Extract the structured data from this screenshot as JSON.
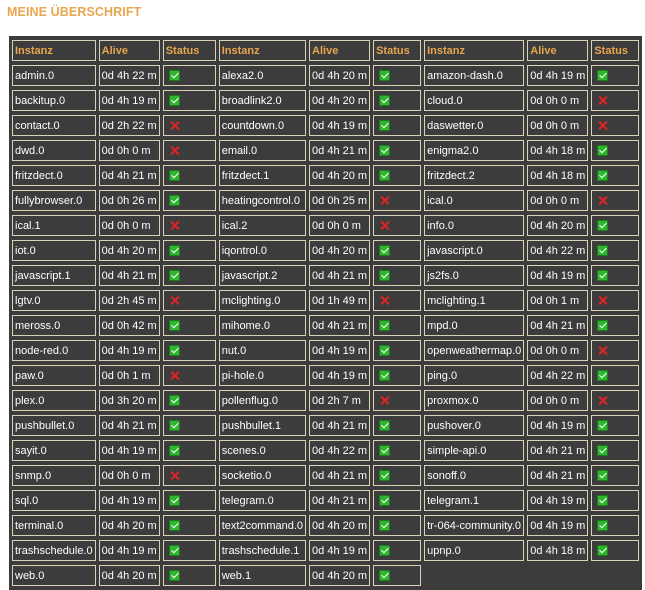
{
  "title": "MEINE ÜBERSCHRIFT",
  "headers": [
    "Instanz",
    "Alive",
    "Status"
  ],
  "colors": {
    "title": "#e8a64e",
    "background": "#3c3c3c",
    "ok": "#2fb52f",
    "fail": "#e02424"
  },
  "rows": [
    [
      {
        "name": "admin.0",
        "alive": "0d 4h 22 m",
        "ok": true
      },
      {
        "name": "alexa2.0",
        "alive": "0d 4h 20 m",
        "ok": true
      },
      {
        "name": "amazon-dash.0",
        "alive": "0d 4h 19 m",
        "ok": true
      }
    ],
    [
      {
        "name": "backitup.0",
        "alive": "0d 4h 19 m",
        "ok": true
      },
      {
        "name": "broadlink2.0",
        "alive": "0d 4h 20 m",
        "ok": true
      },
      {
        "name": "cloud.0",
        "alive": "0d 0h 0 m",
        "ok": false
      }
    ],
    [
      {
        "name": "contact.0",
        "alive": "0d 2h 22 m",
        "ok": false
      },
      {
        "name": "countdown.0",
        "alive": "0d 4h 19 m",
        "ok": true
      },
      {
        "name": "daswetter.0",
        "alive": "0d 0h 0 m",
        "ok": false
      }
    ],
    [
      {
        "name": "dwd.0",
        "alive": "0d 0h 0 m",
        "ok": false
      },
      {
        "name": "email.0",
        "alive": "0d 4h 21 m",
        "ok": true
      },
      {
        "name": "enigma2.0",
        "alive": "0d 4h 18 m",
        "ok": true
      }
    ],
    [
      {
        "name": "fritzdect.0",
        "alive": "0d 4h 21 m",
        "ok": true
      },
      {
        "name": "fritzdect.1",
        "alive": "0d 4h 20 m",
        "ok": true
      },
      {
        "name": "fritzdect.2",
        "alive": "0d 4h 18 m",
        "ok": true
      }
    ],
    [
      {
        "name": "fullybrowser.0",
        "alive": "0d 0h 26 m",
        "ok": true
      },
      {
        "name": "heatingcontrol.0",
        "alive": "0d 0h 25 m",
        "ok": false
      },
      {
        "name": "ical.0",
        "alive": "0d 0h 0 m",
        "ok": false
      }
    ],
    [
      {
        "name": "ical.1",
        "alive": "0d 0h 0 m",
        "ok": false
      },
      {
        "name": "ical.2",
        "alive": "0d 0h 0 m",
        "ok": false
      },
      {
        "name": "info.0",
        "alive": "0d 4h 20 m",
        "ok": true
      }
    ],
    [
      {
        "name": "iot.0",
        "alive": "0d 4h 20 m",
        "ok": true
      },
      {
        "name": "iqontrol.0",
        "alive": "0d 4h 20 m",
        "ok": true
      },
      {
        "name": "javascript.0",
        "alive": "0d 4h 22 m",
        "ok": true
      }
    ],
    [
      {
        "name": "javascript.1",
        "alive": "0d 4h 21 m",
        "ok": true
      },
      {
        "name": "javascript.2",
        "alive": "0d 4h 21 m",
        "ok": true
      },
      {
        "name": "js2fs.0",
        "alive": "0d 4h 19 m",
        "ok": true
      }
    ],
    [
      {
        "name": "lgtv.0",
        "alive": "0d 2h 45 m",
        "ok": false
      },
      {
        "name": "mclighting.0",
        "alive": "0d 1h 49 m",
        "ok": false
      },
      {
        "name": "mclighting.1",
        "alive": "0d 0h 1 m",
        "ok": false
      }
    ],
    [
      {
        "name": "meross.0",
        "alive": "0d 0h 42 m",
        "ok": true
      },
      {
        "name": "mihome.0",
        "alive": "0d 4h 21 m",
        "ok": true
      },
      {
        "name": "mpd.0",
        "alive": "0d 4h 21 m",
        "ok": true
      }
    ],
    [
      {
        "name": "node-red.0",
        "alive": "0d 4h 19 m",
        "ok": true
      },
      {
        "name": "nut.0",
        "alive": "0d 4h 19 m",
        "ok": true
      },
      {
        "name": "openweathermap.0",
        "alive": "0d 0h 0 m",
        "ok": false
      }
    ],
    [
      {
        "name": "paw.0",
        "alive": "0d 0h 1 m",
        "ok": false
      },
      {
        "name": "pi-hole.0",
        "alive": "0d 4h 19 m",
        "ok": true
      },
      {
        "name": "ping.0",
        "alive": "0d 4h 22 m",
        "ok": true
      }
    ],
    [
      {
        "name": "plex.0",
        "alive": "0d 3h 20 m",
        "ok": true
      },
      {
        "name": "pollenflug.0",
        "alive": "0d 2h 7 m",
        "ok": false
      },
      {
        "name": "proxmox.0",
        "alive": "0d 0h 0 m",
        "ok": false
      }
    ],
    [
      {
        "name": "pushbullet.0",
        "alive": "0d 4h 21 m",
        "ok": true
      },
      {
        "name": "pushbullet.1",
        "alive": "0d 4h 21 m",
        "ok": true
      },
      {
        "name": "pushover.0",
        "alive": "0d 4h 19 m",
        "ok": true
      }
    ],
    [
      {
        "name": "sayit.0",
        "alive": "0d 4h 19 m",
        "ok": true
      },
      {
        "name": "scenes.0",
        "alive": "0d 4h 22 m",
        "ok": true
      },
      {
        "name": "simple-api.0",
        "alive": "0d 4h 21 m",
        "ok": true
      }
    ],
    [
      {
        "name": "snmp.0",
        "alive": "0d 0h 0 m",
        "ok": false
      },
      {
        "name": "socketio.0",
        "alive": "0d 4h 21 m",
        "ok": true
      },
      {
        "name": "sonoff.0",
        "alive": "0d 4h 21 m",
        "ok": true
      }
    ],
    [
      {
        "name": "sql.0",
        "alive": "0d 4h 19 m",
        "ok": true
      },
      {
        "name": "telegram.0",
        "alive": "0d 4h 21 m",
        "ok": true
      },
      {
        "name": "telegram.1",
        "alive": "0d 4h 19 m",
        "ok": true
      }
    ],
    [
      {
        "name": "terminal.0",
        "alive": "0d 4h 20 m",
        "ok": true
      },
      {
        "name": "text2command.0",
        "alive": "0d 4h 20 m",
        "ok": true
      },
      {
        "name": "tr-064-community.0",
        "alive": "0d 4h 19 m",
        "ok": true
      }
    ],
    [
      {
        "name": "trashschedule.0",
        "alive": "0d 4h 19 m",
        "ok": true
      },
      {
        "name": "trashschedule.1",
        "alive": "0d 4h 19 m",
        "ok": true
      },
      {
        "name": "upnp.0",
        "alive": "0d 4h 18 m",
        "ok": true
      }
    ],
    [
      {
        "name": "web.0",
        "alive": "0d 4h 20 m",
        "ok": true
      },
      {
        "name": "web.1",
        "alive": "0d 4h 20 m",
        "ok": true
      },
      null
    ]
  ]
}
